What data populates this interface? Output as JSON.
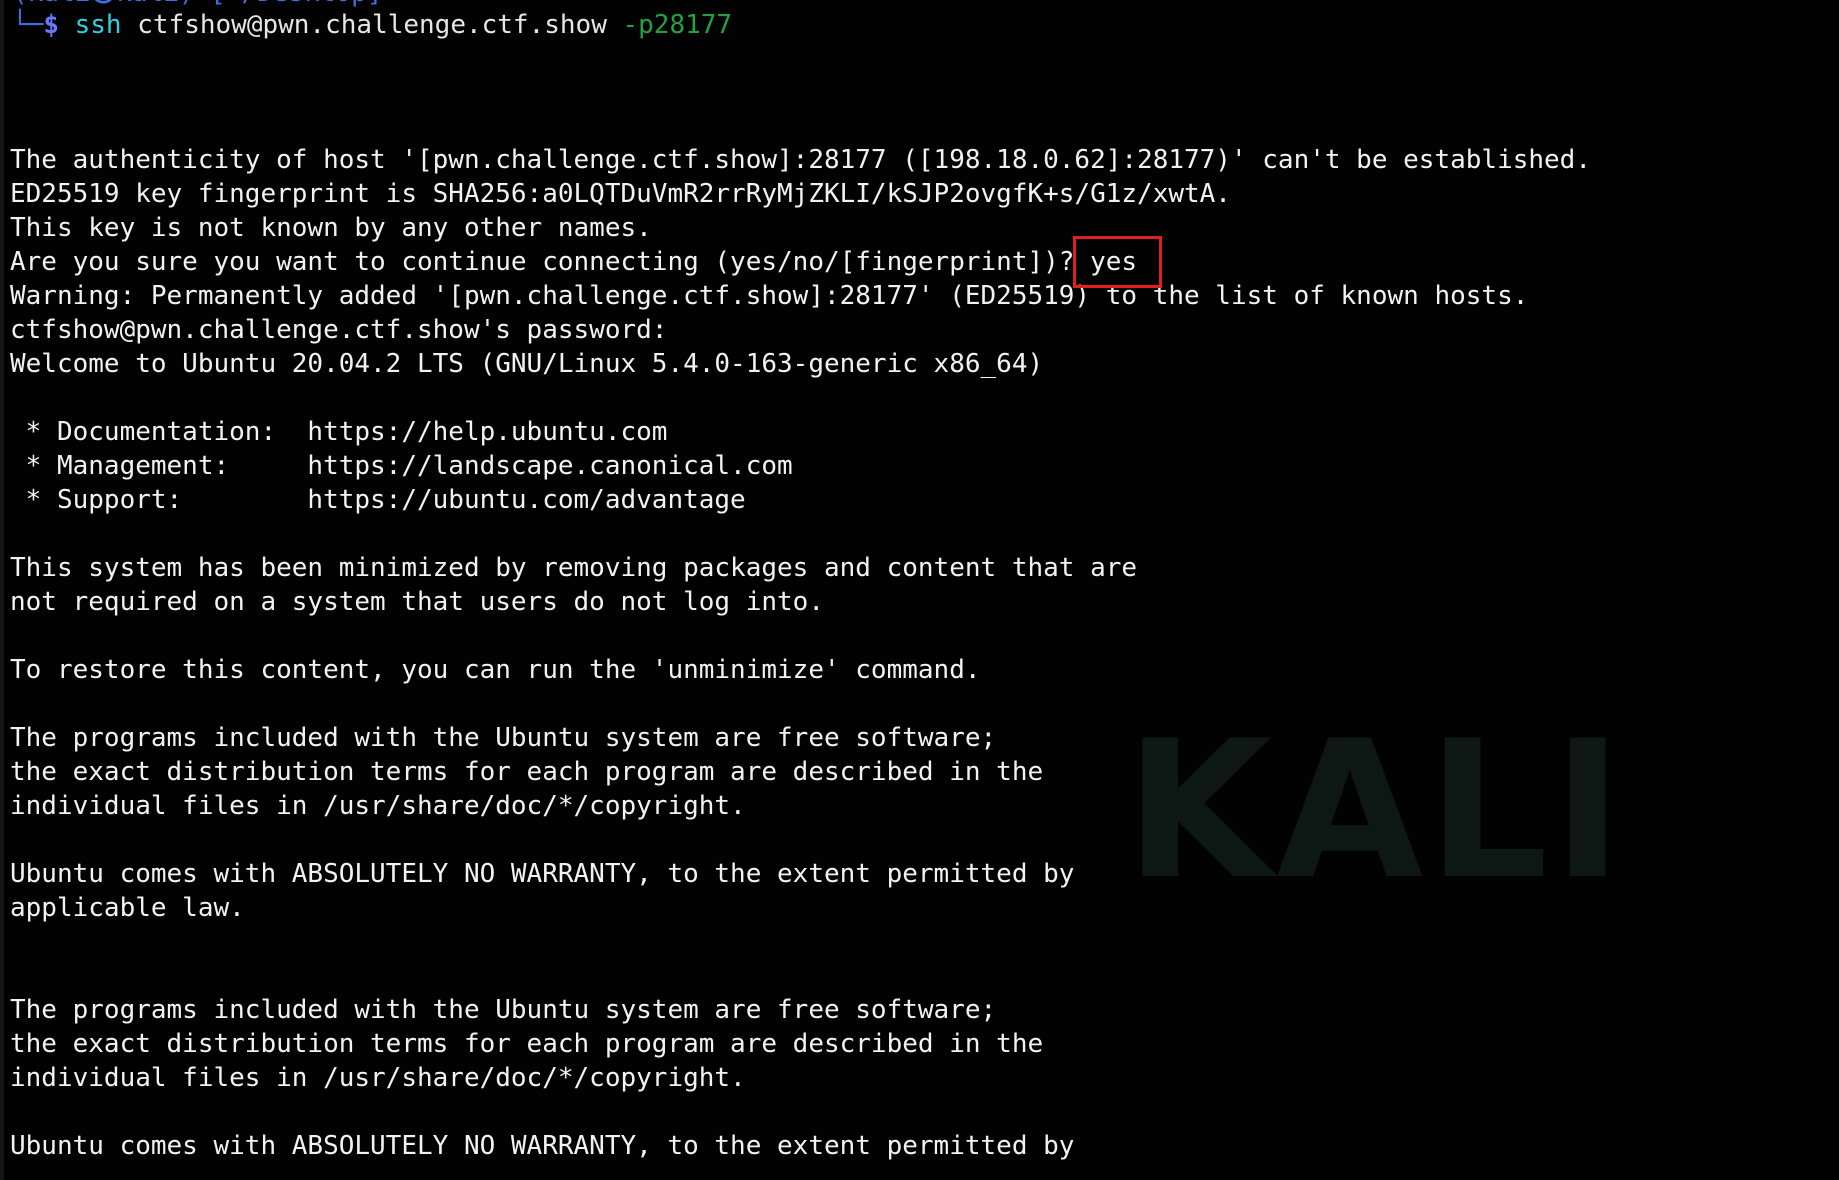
{
  "terminal": {
    "prompt_top_fragment": "(kali㉿kali) [~/Desktop]",
    "prompt_corner": "└─",
    "prompt_symbol": "$",
    "command": {
      "name": "ssh",
      "target": " ctfshow@pwn.challenge.ctf.show ",
      "port_flag": "-p28177"
    },
    "lines": [
      "The authenticity of host '[pwn.challenge.ctf.show]:28177 ([198.18.0.62]:28177)' can't be established.",
      "ED25519 key fingerprint is SHA256:a0LQTDuVmR2rrRyMjZKLI/kSJP2ovgfK+s/G1z/xwtA.",
      "This key is not known by any other names.",
      "Are you sure you want to continue connecting (yes/no/[fingerprint])? ",
      "Warning: Permanently added '[pwn.challenge.ctf.show]:28177' (ED25519) to the list of known hosts.",
      "ctfshow@pwn.challenge.ctf.show's password:",
      "Welcome to Ubuntu 20.04.2 LTS (GNU/Linux 5.4.0-163-generic x86_64)",
      "",
      " * Documentation:  https://help.ubuntu.com",
      " * Management:     https://landscape.canonical.com",
      " * Support:        https://ubuntu.com/advantage",
      "",
      "This system has been minimized by removing packages and content that are",
      "not required on a system that users do not log into.",
      "",
      "To restore this content, you can run the 'unminimize' command.",
      "",
      "The programs included with the Ubuntu system are free software;",
      "the exact distribution terms for each program are described in the",
      "individual files in /usr/share/doc/*/copyright.",
      "",
      "Ubuntu comes with ABSOLUTELY NO WARRANTY, to the extent permitted by",
      "applicable law.",
      "",
      "",
      "The programs included with the Ubuntu system are free software;",
      "the exact distribution terms for each program are described in the",
      "individual files in /usr/share/doc/*/copyright.",
      "",
      "Ubuntu comes with ABSOLUTELY NO WARRANTY, to the extent permitted by"
    ],
    "answer": "yes",
    "wallpaper_text": "KALI",
    "colors": {
      "background": "#020202",
      "text": "#f2f2f2",
      "command": "#2fd1e0",
      "port_flag": "#23a043",
      "prompt": "#6b78ff",
      "highlight_box": "#e0201c"
    }
  }
}
